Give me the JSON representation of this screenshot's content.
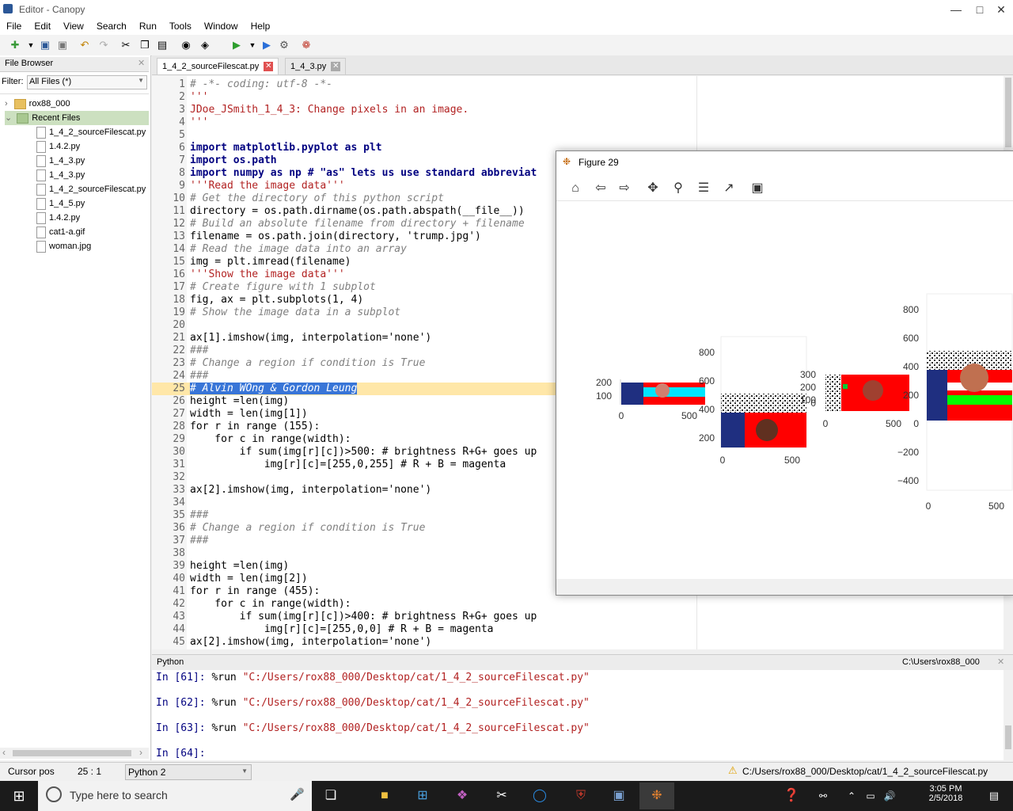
{
  "window": {
    "title": "Editor - Canopy"
  },
  "menu": [
    "File",
    "Edit",
    "View",
    "Search",
    "Run",
    "Tools",
    "Window",
    "Help"
  ],
  "file_browser": {
    "header": "File Browser",
    "filter_label": "Filter:",
    "filter_value": "All Files (*)",
    "tree": [
      {
        "label": "rox88_000",
        "type": "folder"
      },
      {
        "label": "Recent Files",
        "type": "folder",
        "selected": true
      },
      {
        "label": "1_4_2_sourceFilescat.py",
        "type": "file"
      },
      {
        "label": "1.4.2.py",
        "type": "file"
      },
      {
        "label": "1_4_3.py",
        "type": "file"
      },
      {
        "label": "1_4_3.py",
        "type": "file"
      },
      {
        "label": "1_4_2_sourceFilescat.py",
        "type": "file"
      },
      {
        "label": "1_4_5.py",
        "type": "file"
      },
      {
        "label": "1.4.2.py",
        "type": "file"
      },
      {
        "label": "cat1-a.gif",
        "type": "file"
      },
      {
        "label": "woman.jpg",
        "type": "file"
      }
    ]
  },
  "editor": {
    "tabs": [
      {
        "label": "1_4_2_sourceFilescat.py",
        "active": true
      },
      {
        "label": "1_4_3.py",
        "active": false
      }
    ],
    "lines": [
      {
        "n": "1",
        "t": "# -*- coding: utf-8 -*-",
        "k": "cm"
      },
      {
        "n": "2",
        "t": "'''",
        "k": "st"
      },
      {
        "n": "3",
        "t": "JDoe_JSmith_1_4_3: Change pixels in an image.",
        "k": "st"
      },
      {
        "n": "4",
        "t": "'''",
        "k": "st"
      },
      {
        "n": "5",
        "t": "",
        "k": ""
      },
      {
        "n": "6",
        "t": "import matplotlib.pyplot as plt",
        "k": "kw"
      },
      {
        "n": "7",
        "t": "import os.path",
        "k": "kw"
      },
      {
        "n": "8",
        "t": "import numpy as np # \"as\" lets us use standard abbreviat",
        "k": "kw"
      },
      {
        "n": "9",
        "t": "'''Read the image data'''",
        "k": "st"
      },
      {
        "n": "10",
        "t": "# Get the directory of this python script",
        "k": "cm"
      },
      {
        "n": "11",
        "t": "directory = os.path.dirname(os.path.abspath(__file__))",
        "k": ""
      },
      {
        "n": "12",
        "t": "# Build an absolute filename from directory + filename",
        "k": "cm"
      },
      {
        "n": "13",
        "t": "filename = os.path.join(directory, 'trump.jpg')",
        "k": ""
      },
      {
        "n": "14",
        "t": "# Read the image data into an array",
        "k": "cm"
      },
      {
        "n": "15",
        "t": "img = plt.imread(filename)",
        "k": ""
      },
      {
        "n": "16",
        "t": "'''Show the image data'''",
        "k": "st"
      },
      {
        "n": "17",
        "t": "# Create figure with 1 subplot",
        "k": "cm"
      },
      {
        "n": "18",
        "t": "fig, ax = plt.subplots(1, 4)",
        "k": ""
      },
      {
        "n": "19",
        "t": "# Show the image data in a subplot",
        "k": "cm"
      },
      {
        "n": "20",
        "t": "",
        "k": ""
      },
      {
        "n": "21",
        "t": "ax[1].imshow(img, interpolation='none')",
        "k": ""
      },
      {
        "n": "22",
        "t": "###",
        "k": "cm"
      },
      {
        "n": "23",
        "t": "# Change a region if condition is True",
        "k": "cm"
      },
      {
        "n": "24",
        "t": "###",
        "k": "cm"
      },
      {
        "n": "25",
        "t": "# Alvin WOng & Gordon Leung",
        "k": "sel"
      },
      {
        "n": "26",
        "t": "height =len(img)",
        "k": ""
      },
      {
        "n": "27",
        "t": "width = len(img[1])",
        "k": ""
      },
      {
        "n": "28",
        "t": "for r in range (155):",
        "k": ""
      },
      {
        "n": "29",
        "t": "    for c in range(width):",
        "k": ""
      },
      {
        "n": "30",
        "t": "        if sum(img[r][c])>500: # brightness R+G+ goes up",
        "k": ""
      },
      {
        "n": "31",
        "t": "            img[r][c]=[255,0,255] # R + B = magenta",
        "k": ""
      },
      {
        "n": "32",
        "t": "",
        "k": ""
      },
      {
        "n": "33",
        "t": "ax[2].imshow(img, interpolation='none')",
        "k": ""
      },
      {
        "n": "34",
        "t": "",
        "k": ""
      },
      {
        "n": "35",
        "t": "###",
        "k": "cm"
      },
      {
        "n": "36",
        "t": "# Change a region if condition is True",
        "k": "cm"
      },
      {
        "n": "37",
        "t": "###",
        "k": "cm"
      },
      {
        "n": "38",
        "t": "",
        "k": ""
      },
      {
        "n": "39",
        "t": "height =len(img)",
        "k": ""
      },
      {
        "n": "40",
        "t": "width = len(img[2])",
        "k": ""
      },
      {
        "n": "41",
        "t": "for r in range (455):",
        "k": ""
      },
      {
        "n": "42",
        "t": "    for c in range(width):",
        "k": ""
      },
      {
        "n": "43",
        "t": "        if sum(img[r][c])>400: # brightness R+G+ goes up",
        "k": ""
      },
      {
        "n": "44",
        "t": "            img[r][c]=[255,0,0] # R + B = magenta",
        "k": ""
      },
      {
        "n": "45",
        "t": "ax[2].imshow(img, interpolation='none')",
        "k": ""
      }
    ]
  },
  "python_pane": {
    "header": "Python",
    "cwd": "C:\\Users\\rox88_000",
    "lines": [
      {
        "prompt": "In [61]:",
        "cmd": " %run ",
        "path": "\"C:/Users/rox88_000/Desktop/cat/1_4_2_sourceFilescat.py\""
      },
      {
        "prompt": "In [62]:",
        "cmd": " %run ",
        "path": "\"C:/Users/rox88_000/Desktop/cat/1_4_2_sourceFilescat.py\""
      },
      {
        "prompt": "In [63]:",
        "cmd": " %run ",
        "path": "\"C:/Users/rox88_000/Desktop/cat/1_4_2_sourceFilescat.py\""
      },
      {
        "prompt": "In [64]:",
        "cmd": "",
        "path": ""
      }
    ]
  },
  "status": {
    "cursor_label": "Cursor pos",
    "cursor_value": "25 : 1",
    "language": "Python 2",
    "path": "C:/Users/rox88_000/Desktop/cat/1_4_2_sourceFilescat.py"
  },
  "figure": {
    "title": "Figure 29",
    "axes": [
      {
        "yticks": [
          "200",
          "100"
        ],
        "xticks": [
          "0",
          "500"
        ]
      },
      {
        "yticks": [
          "800",
          "600",
          "400",
          "200"
        ],
        "xticks": [
          "0",
          "500"
        ]
      },
      {
        "yticks": [
          "300",
          "200",
          "100",
          "0"
        ],
        "xticks": [
          "0",
          "500"
        ]
      },
      {
        "yticks": [
          "800",
          "600",
          "400",
          "200",
          "0",
          "−200",
          "−400"
        ],
        "xticks": [
          "0",
          "500"
        ]
      }
    ]
  },
  "taskbar": {
    "search_placeholder": "Type here to search",
    "time": "3:05 PM",
    "date": "2/5/2018"
  }
}
